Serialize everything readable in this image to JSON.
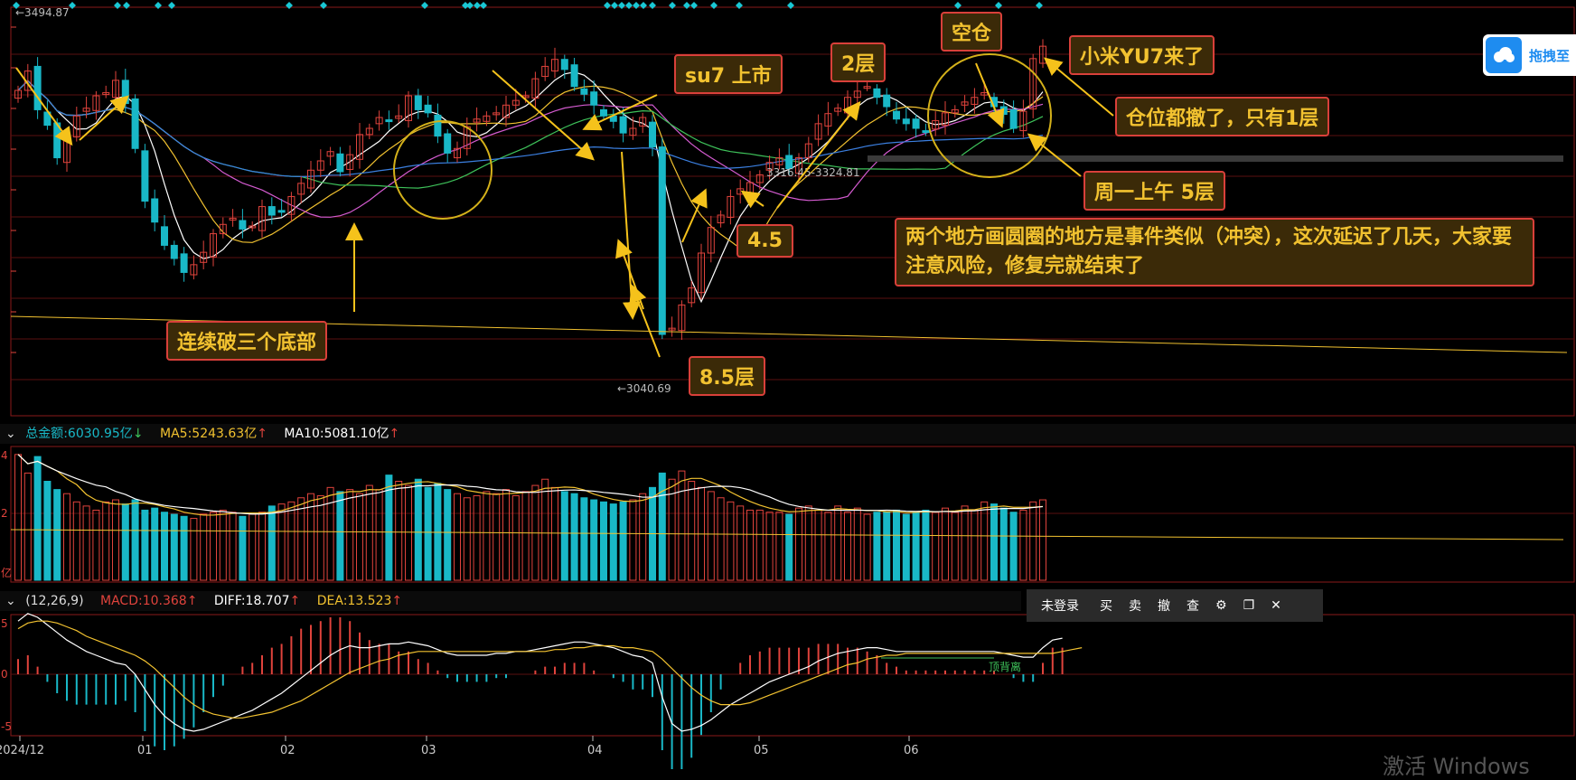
{
  "chart_data": [
    {
      "type": "candlestick",
      "panel": "price",
      "xlabel": "",
      "ylabel": "",
      "x_ticks": [
        "2024/12",
        "01",
        "02",
        "03",
        "04",
        "05",
        "06"
      ],
      "marks": {
        "high_label": "←3494.87",
        "low_label": "←3040.69",
        "range_label": "3316.45-3324.81"
      },
      "close_values": [
        3405,
        3430,
        3380,
        3360,
        3318,
        3345,
        3372,
        3382,
        3398,
        3402,
        3418,
        3388,
        3330,
        3262,
        3235,
        3205,
        3188,
        3170,
        3180,
        3196,
        3220,
        3232,
        3240,
        3226,
        3230,
        3255,
        3244,
        3248,
        3268,
        3285,
        3302,
        3314,
        3326,
        3300,
        3322,
        3348,
        3356,
        3370,
        3366,
        3372,
        3398,
        3380,
        3376,
        3346,
        3324,
        3330,
        3358,
        3368,
        3372,
        3376,
        3386,
        3392,
        3398,
        3420,
        3436,
        3445,
        3432,
        3410,
        3400,
        3386,
        3372,
        3365,
        3350,
        3356,
        3370,
        3332,
        3090,
        3098,
        3128,
        3150,
        3195,
        3228,
        3244,
        3268,
        3278,
        3286,
        3296,
        3312,
        3318,
        3304,
        3318,
        3336,
        3362,
        3375,
        3382,
        3396,
        3404,
        3410,
        3396,
        3384,
        3368,
        3362,
        3356,
        3352,
        3366,
        3376,
        3380,
        3390,
        3396,
        3402,
        3384,
        3374,
        3356,
        3378,
        3446,
        3462
      ],
      "moving_averages": [
        "MA5",
        "MA10",
        "MA20",
        "MA30",
        "MA60"
      ]
    },
    {
      "type": "bar",
      "panel": "volume",
      "series": [
        {
          "name": "总金额",
          "value": "6030.95亿"
        },
        {
          "name": "MA5",
          "value": "5243.63亿"
        },
        {
          "name": "MA10",
          "value": "5081.10亿"
        }
      ],
      "values": [
        6.1,
        5.2,
        6.0,
        4.8,
        4.4,
        4.2,
        3.8,
        3.6,
        3.4,
        3.8,
        3.9,
        3.7,
        3.9,
        3.4,
        3.5,
        3.3,
        3.2,
        3.1,
        3.0,
        3.2,
        3.3,
        3.4,
        3.3,
        3.1,
        3.2,
        3.3,
        3.6,
        3.7,
        3.8,
        4.0,
        4.2,
        4.1,
        4.5,
        4.3,
        4.4,
        4.2,
        4.6,
        4.4,
        5.1,
        4.8,
        4.6,
        4.9,
        4.5,
        4.7,
        4.4,
        4.2,
        4.0,
        4.1,
        4.3,
        4.2,
        4.4,
        4.1,
        4.3,
        4.6,
        4.9,
        4.5,
        4.3,
        4.2,
        4.0,
        3.9,
        3.8,
        3.7,
        3.8,
        3.9,
        4.2,
        4.5,
        5.2,
        4.9,
        5.3,
        4.8,
        4.5,
        4.3,
        4.0,
        3.8,
        3.6,
        3.4,
        3.4,
        3.3,
        3.3,
        3.2,
        3.5,
        3.6,
        3.4,
        3.3,
        3.6,
        3.3,
        3.5,
        3.2,
        3.3,
        3.3,
        3.4,
        3.2,
        3.3,
        3.4,
        3.3,
        3.5,
        3.3,
        3.6,
        3.4,
        3.8,
        3.7,
        3.5,
        3.3,
        3.4,
        3.8,
        3.9
      ],
      "axis_ticks": [
        "4",
        "2",
        "亿"
      ]
    },
    {
      "type": "macd",
      "panel": "macd",
      "params": "(12,26,9)",
      "series": [
        {
          "name": "MACD",
          "value": "10.368"
        },
        {
          "name": "DIFF",
          "value": "18.707"
        },
        {
          "name": "DEA",
          "value": "13.523"
        }
      ],
      "diff": [
        28,
        32,
        30,
        26,
        22,
        18,
        15,
        12,
        10,
        8,
        6,
        5,
        0,
        -8,
        -16,
        -22,
        -26,
        -29,
        -30,
        -29,
        -27,
        -25,
        -23,
        -21,
        -19,
        -16,
        -13,
        -10,
        -6,
        -2,
        2,
        6,
        10,
        13,
        15,
        14,
        14,
        15,
        16,
        16,
        17,
        16,
        15,
        13,
        11,
        10,
        10,
        10,
        10,
        11,
        11,
        12,
        12,
        13,
        14,
        15,
        16,
        17,
        17,
        16,
        15,
        14,
        12,
        10,
        9,
        6,
        -12,
        -26,
        -30,
        -29,
        -27,
        -24,
        -20,
        -16,
        -13,
        -10,
        -7,
        -4,
        -2,
        0,
        2,
        4,
        7,
        9,
        11,
        12,
        13,
        14,
        14,
        13,
        12,
        12,
        12,
        12,
        12,
        12,
        12,
        12,
        12,
        12,
        12,
        11,
        10,
        9,
        9,
        14,
        18,
        19
      ],
      "dea": [
        24,
        27,
        28,
        28,
        27,
        25,
        23,
        20,
        18,
        16,
        14,
        12,
        10,
        7,
        3,
        -2,
        -7,
        -12,
        -16,
        -19,
        -21,
        -22,
        -23,
        -23,
        -22,
        -21,
        -20,
        -18,
        -16,
        -14,
        -11,
        -8,
        -5,
        -2,
        1,
        3,
        5,
        7,
        8,
        10,
        11,
        12,
        12,
        12,
        12,
        12,
        12,
        12,
        12,
        12,
        12,
        12,
        12,
        12,
        12,
        13,
        13,
        14,
        14,
        15,
        15,
        15,
        14,
        14,
        13,
        12,
        8,
        3,
        -2,
        -7,
        -11,
        -14,
        -16,
        -16,
        -16,
        -15,
        -13,
        -11,
        -9,
        -7,
        -5,
        -3,
        -1,
        1,
        3,
        5,
        6,
        8,
        9,
        10,
        10,
        11,
        11,
        11,
        11,
        11,
        11,
        11,
        11,
        11,
        11,
        11,
        11,
        11,
        11,
        11,
        11,
        12,
        13,
        14
      ],
      "annotation": "顶背离",
      "axis_ticks": [
        "5",
        "0",
        "-5"
      ]
    }
  ],
  "annotations": {
    "su7_launch": "su7 上市",
    "level_2": "2层",
    "empty_position": "空仓",
    "yu7": "小米YU7来了",
    "only_1": "仓位都撤了，只有1层",
    "monday_5": "周一上午 5层",
    "level_45": "4.5",
    "note": "两个地方画圆圈的地方是事件类似（冲突），这次延迟了几天，大家要注意风险，修复完就结束了",
    "three_bottoms": "连续破三个底部",
    "level_85": "8.5层"
  },
  "toolbar": {
    "login": "未登录",
    "buy": "买",
    "sell": "卖",
    "cancel": "撤",
    "query": "查"
  },
  "side_widget": {
    "label": "拖拽至"
  },
  "watermark": "激活 Windows",
  "colors": {
    "up": "#e0433c",
    "down": "#19b8c7",
    "ma5": "#ffffff",
    "ma10": "#f2c230",
    "ma20": "#d45bd0",
    "ma30": "#3ec25a",
    "ma60": "#3b7fe0",
    "grid": "#5a1010",
    "arrow": "#f5c21b"
  }
}
